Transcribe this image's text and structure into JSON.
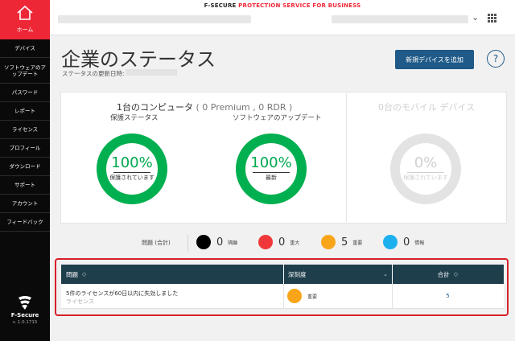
{
  "sidebar": {
    "home_label": "ホーム",
    "items": [
      {
        "label": "デバイス",
        "tall": false
      },
      {
        "label": "ソフトウェアのアップデート",
        "tall": true
      },
      {
        "label": "パスワード",
        "tall": false
      },
      {
        "label": "レポート",
        "tall": false
      },
      {
        "label": "ライセンス",
        "tall": false
      },
      {
        "label": "プロフィール",
        "tall": false
      },
      {
        "label": "ダウンロード",
        "tall": false
      },
      {
        "label": "サポート",
        "tall": false
      },
      {
        "label": "アカウント",
        "tall": false
      },
      {
        "label": "フィードバック",
        "tall": false
      }
    ],
    "brand_name": "F-Secure",
    "version": "v. 1.0.1715"
  },
  "header": {
    "brand": "F-SECURE",
    "service": "PROTECTION SERVICE FOR BUSINESS"
  },
  "page": {
    "title": "企業のステータス",
    "updated_label": "ステータスの更新日時:",
    "add_device_button": "新規デバイスを追加",
    "help_label": "?"
  },
  "status": {
    "computers_heading": "1台のコンピュータ",
    "computers_detail": "( 0 Premium , 0 RDR )",
    "mobile_heading": "0台のモバイル デバイス",
    "protection": {
      "label": "保護ステータス",
      "percent": 100,
      "percent_text": "100%",
      "sub": "保護されています"
    },
    "updates": {
      "label": "ソフトウェアのアップデート",
      "percent": 100,
      "percent_text": "100%",
      "sub": "最新"
    },
    "mobile": {
      "percent": 0,
      "percent_text": "0%",
      "sub": "保護されています"
    }
  },
  "legend": {
    "title": "問題 (合計)",
    "items": [
      {
        "count": "0",
        "name": "隔離",
        "color": "#000000"
      },
      {
        "count": "0",
        "name": "重大",
        "color": "#f0383b"
      },
      {
        "count": "5",
        "name": "重要",
        "color": "#f9a51a"
      },
      {
        "count": "0",
        "name": "情報",
        "color": "#1cb0ee"
      }
    ]
  },
  "table": {
    "headers": {
      "issue": "問題",
      "severity": "深刻度",
      "total": "合計"
    },
    "rows": [
      {
        "issue": "5件のライセンスが60日以内に失効しました",
        "sub": "ライセンス",
        "severity": "重要",
        "severity_color": "#f9a51a",
        "total": "5"
      }
    ]
  },
  "colors": {
    "accent_red": "#ee2737",
    "ring_green": "#00b050",
    "ring_gray": "#d9d9d9",
    "primary_blue": "#1f5a88",
    "table_header": "#1f3e4c"
  }
}
